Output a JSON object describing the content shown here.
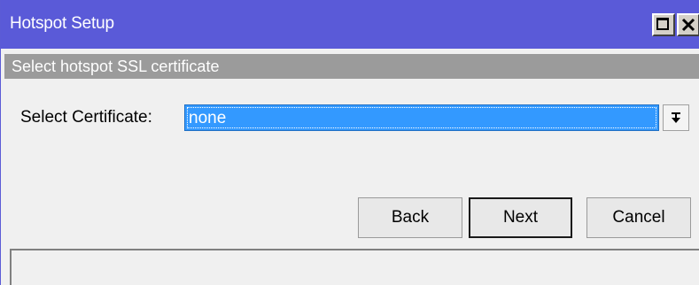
{
  "window": {
    "title": "Hotspot Setup",
    "maximize_icon": "maximize-icon",
    "close_icon": "close-icon"
  },
  "section": {
    "header": "Select hotspot SSL certificate"
  },
  "form": {
    "certificate_label": "Select Certificate:",
    "certificate_value": "none",
    "dropdown_icon": "dropdown-arrow-icon"
  },
  "buttons": {
    "back": "Back",
    "next": "Next",
    "cancel": "Cancel"
  },
  "colors": {
    "titlebar": "#5a5ad8",
    "section_header": "#9b9b9b",
    "selection": "#3399ff"
  }
}
